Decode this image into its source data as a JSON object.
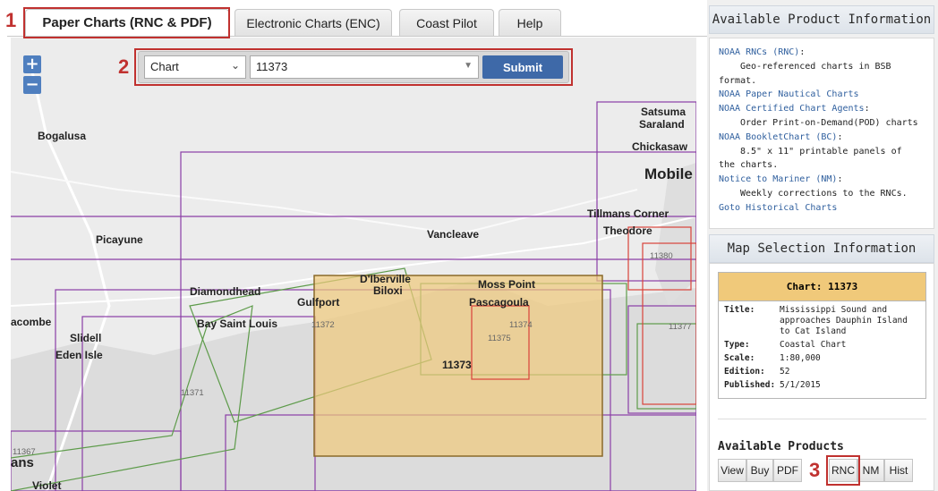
{
  "tabs": [
    {
      "label": "Paper Charts (RNC & PDF)",
      "active": true
    },
    {
      "label": "Electronic Charts (ENC)",
      "active": false
    },
    {
      "label": "Coast Pilot",
      "active": false
    },
    {
      "label": "Help",
      "active": false
    }
  ],
  "callouts": [
    "1",
    "2",
    "3"
  ],
  "map": {
    "zoom_in": "+",
    "zoom_out": "−",
    "places": [
      "Bogalusa",
      "Picayune",
      "Vancleave",
      "Satsuma",
      "Saraland",
      "Chickasaw",
      "Mobile",
      "Tillmans Corner",
      "Theodore",
      "Diamondhead",
      "D'Iberville",
      "Biloxi",
      "Gulfport",
      "Moss Point",
      "Pascagoula",
      "Bay Saint Louis",
      "Slidell",
      "Eden Isle",
      "acombe",
      "Violet",
      "ans"
    ],
    "chart_labels": [
      "11380",
      "11372",
      "11374",
      "11375",
      "11373",
      "11377",
      "11371",
      "11367"
    ]
  },
  "toolbar": {
    "type_value": "Chart",
    "chart_value": "11373",
    "submit_label": "Submit"
  },
  "product_info": {
    "header": "Available Product Information",
    "lines": [
      {
        "text": "NOAA RNCs (RNC)",
        "suffix": ":",
        "link": true
      },
      {
        "text": "Geo-referenced charts in BSB",
        "indent": true
      },
      {
        "text": "format."
      },
      {
        "text": "NOAA Paper Nautical Charts",
        "link": true
      },
      {
        "text": "NOAA Certified Chart Agents",
        "suffix": ":",
        "link": true
      },
      {
        "text": "Order Print-on-Demand(POD) charts",
        "indent": true
      },
      {
        "text": "NOAA BookletChart (BC)",
        "suffix": ":",
        "link": true
      },
      {
        "text": "8.5\" x 11\" printable panels of",
        "indent": true
      },
      {
        "text": "the charts."
      },
      {
        "text": "Notice to Mariner (NM)",
        "suffix": ":",
        "link": true
      },
      {
        "text": "Weekly corrections to the RNCs.",
        "indent": true
      },
      {
        "text": "Goto Historical Charts",
        "link": true
      }
    ]
  },
  "map_selection": {
    "header": "Map Selection Information",
    "chart_title": "Chart: 11373",
    "fields": [
      {
        "key": "Title:",
        "value": "Mississippi Sound and approaches Dauphin Island to Cat Island"
      },
      {
        "key": "Type:",
        "value": "Coastal Chart"
      },
      {
        "key": "Scale:",
        "value": "1:80,000"
      },
      {
        "key": "Edition:",
        "value": "52"
      },
      {
        "key": "Published:",
        "value": "5/1/2015"
      }
    ]
  },
  "products": {
    "title": "Available Products",
    "buttons": [
      "View",
      "Buy",
      "PDF",
      "RNC",
      "NM",
      "Hist"
    ]
  },
  "colors": {
    "chart_fill": "#f0c97a",
    "purple": "#8a3ea6",
    "green": "#5d9b4a",
    "red": "#d9423a",
    "callout": "#c0312f"
  }
}
